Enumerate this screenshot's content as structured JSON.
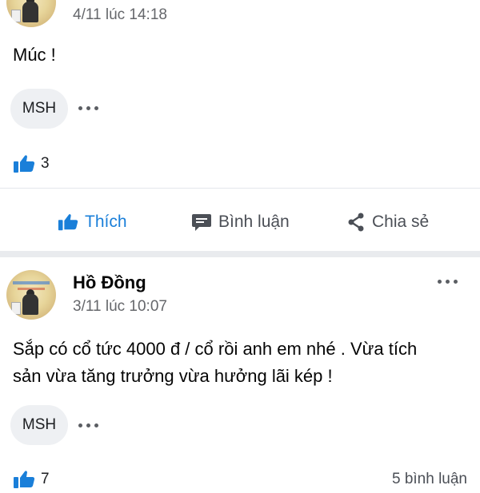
{
  "post1": {
    "timestamp": "4/11 lúc 14:18",
    "text": "Múc !",
    "tag": "MSH",
    "likes": "3"
  },
  "actions": {
    "like": "Thích",
    "comment": "Bình luận",
    "share": "Chia sẻ"
  },
  "post2": {
    "author": "Hồ Đồng",
    "timestamp": "3/11 lúc 10:07",
    "text_line1": "Sắp có cổ tức 4000 đ / cổ rồi anh em nhé . Vừa tích",
    "text_line2": "sản vừa tăng trưởng vừa hưởng lãi kép !",
    "tag": "MSH",
    "likes": "7",
    "comments": "5 bình luận"
  },
  "colors": {
    "accent": "#1a7fd9",
    "muted": "#65676b",
    "chip_bg": "#eef0f3"
  }
}
